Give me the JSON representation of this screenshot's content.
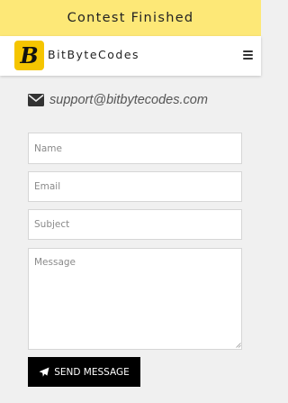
{
  "banner": {
    "text": "Contest Finished"
  },
  "header": {
    "logo_letter": "B",
    "brand": "BitByteCodes",
    "menu_icon": "hamburger-menu-icon",
    "logo_color": "#f5c500"
  },
  "contact": {
    "email_icon": "envelope-icon",
    "email": "support@bitbytecodes.com"
  },
  "form": {
    "name_placeholder": "Name",
    "email_placeholder": "Email",
    "subject_placeholder": "Subject",
    "message_placeholder": "Message",
    "send_label": "SEND MESSAGE",
    "send_icon": "paper-plane-icon"
  },
  "colors": {
    "banner_bg": "#fde877",
    "page_bg": "#f0f0f0",
    "button_bg": "#000000"
  }
}
